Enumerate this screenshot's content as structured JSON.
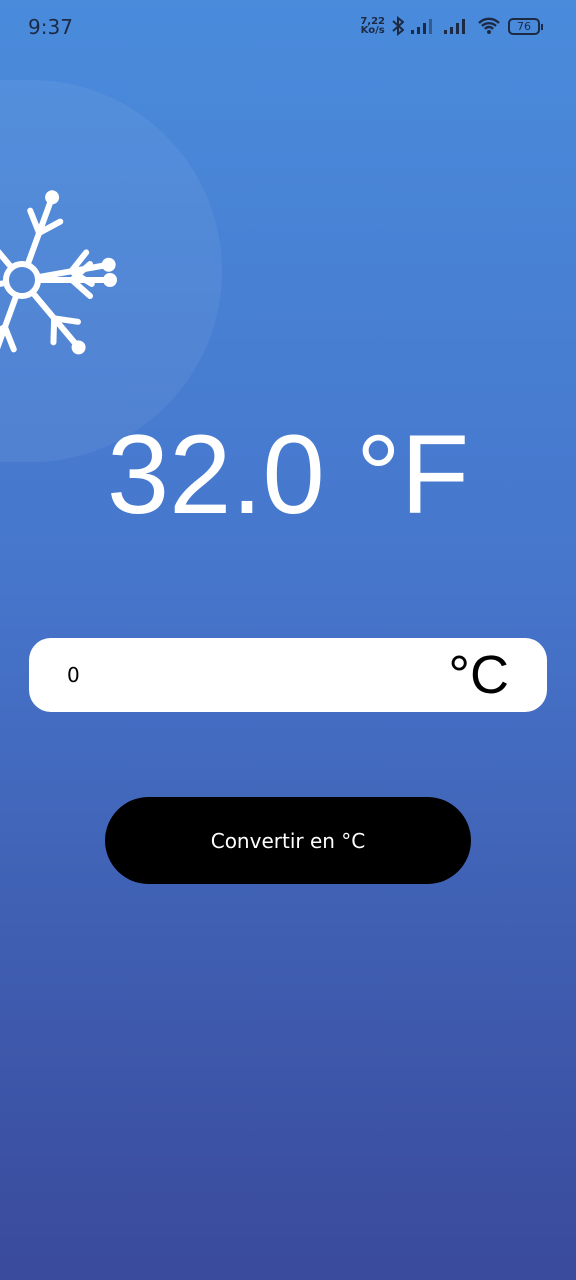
{
  "status_bar": {
    "time": "9:37",
    "net_speed_value": "7,22",
    "net_speed_unit": "Ko/s",
    "battery": "76"
  },
  "icon": "snowflake-icon",
  "result": "32.0 °F",
  "input": {
    "value": "0",
    "unit": "°C"
  },
  "convert_button": "Convertir en °C",
  "colors": {
    "bg_top": "#4a8bdc",
    "bg_bottom": "#3a4a9c",
    "button": "#000000"
  }
}
